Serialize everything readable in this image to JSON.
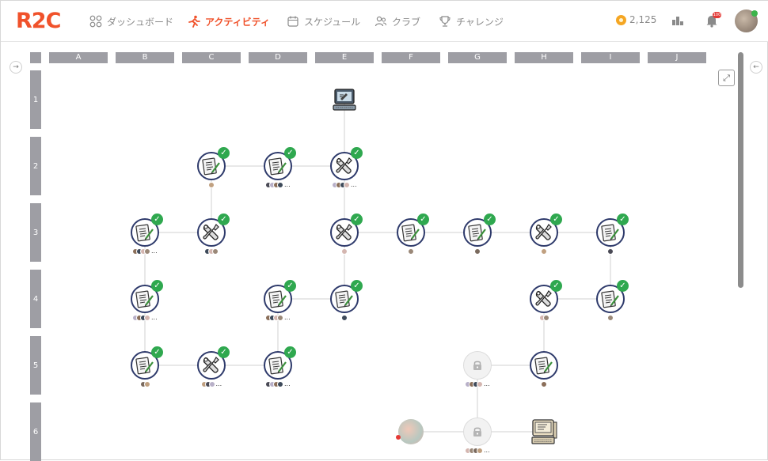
{
  "header": {
    "logo": "R2C",
    "nav": [
      {
        "id": "dashboard",
        "label": "ダッシュボード",
        "icon": "dashboard-grid-icon"
      },
      {
        "id": "activity",
        "label": "アクティビティ",
        "icon": "running-icon",
        "active": true
      },
      {
        "id": "schedule",
        "label": "スケジュール",
        "icon": "calendar-icon"
      },
      {
        "id": "club",
        "label": "クラブ",
        "icon": "group-icon"
      },
      {
        "id": "challenge",
        "label": "チャレンジ",
        "icon": "trophy-icon"
      }
    ],
    "coins": "2,125",
    "notification_badge": "100"
  },
  "grid": {
    "columns": [
      "A",
      "B",
      "C",
      "D",
      "E",
      "F",
      "G",
      "H",
      "I",
      "J"
    ],
    "rows": [
      "1",
      "2",
      "3",
      "4",
      "5",
      "6"
    ]
  },
  "nodes": [
    {
      "id": "e1",
      "cell": "E1",
      "kind": "computer",
      "state": "start"
    },
    {
      "id": "c2",
      "cell": "C2",
      "kind": "document",
      "state": "done",
      "people": 1,
      "more": false
    },
    {
      "id": "d2",
      "cell": "D2",
      "kind": "document",
      "state": "done",
      "people": 4,
      "more": true
    },
    {
      "id": "e2",
      "cell": "E2",
      "kind": "wrench",
      "state": "done",
      "people": 4,
      "more": true
    },
    {
      "id": "b3",
      "cell": "B3",
      "kind": "document",
      "state": "done",
      "people": 4,
      "more": true
    },
    {
      "id": "c3",
      "cell": "C3",
      "kind": "wrench",
      "state": "done",
      "people": 3,
      "more": false
    },
    {
      "id": "e3",
      "cell": "E3",
      "kind": "wrench",
      "state": "done",
      "people": 1,
      "more": false
    },
    {
      "id": "f3",
      "cell": "F3",
      "kind": "document",
      "state": "done",
      "people": 1,
      "more": false
    },
    {
      "id": "g3",
      "cell": "G3",
      "kind": "document",
      "state": "done",
      "people": 1,
      "more": false
    },
    {
      "id": "h3",
      "cell": "H3",
      "kind": "wrench",
      "state": "done",
      "people": 1,
      "more": false
    },
    {
      "id": "i3",
      "cell": "I3",
      "kind": "document",
      "state": "done",
      "people": 1,
      "more": false
    },
    {
      "id": "b4",
      "cell": "B4",
      "kind": "document",
      "state": "done",
      "people": 4,
      "more": true
    },
    {
      "id": "d4",
      "cell": "D4",
      "kind": "document",
      "state": "done",
      "people": 4,
      "more": true
    },
    {
      "id": "e4",
      "cell": "E4",
      "kind": "document",
      "state": "done",
      "people": 1,
      "more": false
    },
    {
      "id": "h4",
      "cell": "H4",
      "kind": "wrench",
      "state": "done",
      "people": 2,
      "more": false
    },
    {
      "id": "i4",
      "cell": "I4",
      "kind": "document",
      "state": "done",
      "people": 1,
      "more": false
    },
    {
      "id": "b5",
      "cell": "B5",
      "kind": "document",
      "state": "done",
      "people": 2,
      "more": false
    },
    {
      "id": "c5",
      "cell": "C5",
      "kind": "wrench",
      "state": "done",
      "people": 3,
      "more": true
    },
    {
      "id": "d5",
      "cell": "D5",
      "kind": "document",
      "state": "done",
      "people": 4,
      "more": true
    },
    {
      "id": "g5",
      "cell": "G5",
      "kind": "lock",
      "state": "locked",
      "people": 4,
      "more": true
    },
    {
      "id": "h5",
      "cell": "H5",
      "kind": "document",
      "state": "open",
      "people": 1,
      "more": false
    },
    {
      "id": "f6",
      "cell": "F6",
      "kind": "avatar",
      "state": "user"
    },
    {
      "id": "g6",
      "cell": "G6",
      "kind": "lock",
      "state": "locked",
      "people": 4,
      "more": true
    },
    {
      "id": "h6",
      "cell": "H6",
      "kind": "retro-computer",
      "state": "start"
    }
  ],
  "links": [
    [
      "e1",
      "e2"
    ],
    [
      "c2",
      "d2"
    ],
    [
      "d2",
      "e2"
    ],
    [
      "c2",
      "c3"
    ],
    [
      "b3",
      "c3"
    ],
    [
      "e2",
      "e3"
    ],
    [
      "e3",
      "f3"
    ],
    [
      "f3",
      "g3"
    ],
    [
      "g3",
      "h3"
    ],
    [
      "h3",
      "i3"
    ],
    [
      "b3",
      "b4"
    ],
    [
      "b4",
      "b5"
    ],
    [
      "b5",
      "c5"
    ],
    [
      "c5",
      "d5"
    ],
    [
      "d5",
      "d4"
    ],
    [
      "d4",
      "e4"
    ],
    [
      "e4",
      "e3"
    ],
    [
      "i3",
      "i4"
    ],
    [
      "h4",
      "i4"
    ],
    [
      "h4",
      "h5"
    ],
    [
      "g5",
      "h5"
    ],
    [
      "g5",
      "g6"
    ],
    [
      "f6",
      "g6"
    ],
    [
      "g6",
      "h6"
    ]
  ],
  "colors": {
    "accent": "#f0522b",
    "node_ring": "#2e3a6b",
    "check": "#2fa84f",
    "header_gray": "#9e9ea4"
  }
}
